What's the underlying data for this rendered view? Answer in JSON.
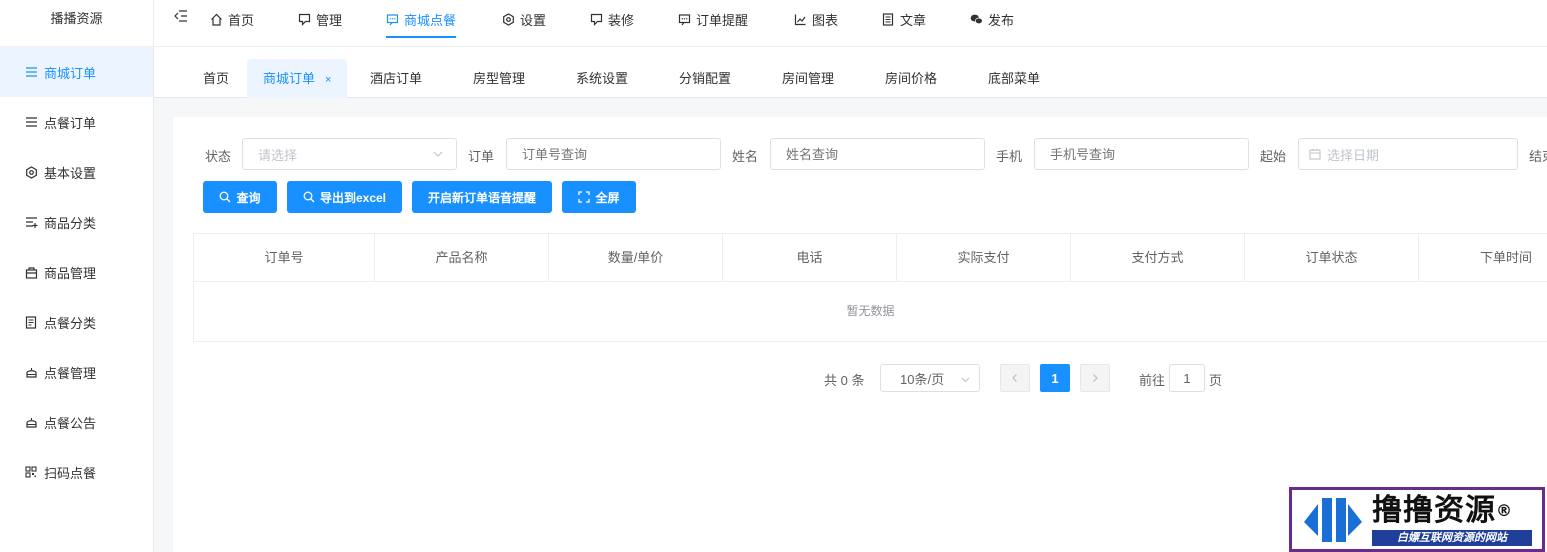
{
  "brand": "播播资源",
  "sidebar": {
    "items": [
      {
        "label": "商城订单",
        "icon": "list-icon",
        "active": true
      },
      {
        "label": "点餐订单",
        "icon": "list-icon"
      },
      {
        "label": "基本设置",
        "icon": "settings-hex-icon"
      },
      {
        "label": "商品分类",
        "icon": "list-add-icon"
      },
      {
        "label": "商品管理",
        "icon": "shop-icon"
      },
      {
        "label": "点餐分类",
        "icon": "document-icon"
      },
      {
        "label": "点餐管理",
        "icon": "cake-icon"
      },
      {
        "label": "点餐公告",
        "icon": "cake-icon"
      },
      {
        "label": "扫码点餐",
        "icon": "qrcode-icon"
      }
    ]
  },
  "topnav": {
    "items": [
      {
        "label": "首页",
        "icon": "home-icon"
      },
      {
        "label": "管理",
        "icon": "chat-square-icon"
      },
      {
        "label": "商城点餐",
        "icon": "message-icon",
        "active": true
      },
      {
        "label": "设置",
        "icon": "gear-icon"
      },
      {
        "label": "装修",
        "icon": "chat-square-icon"
      },
      {
        "label": "订单提醒",
        "icon": "message-icon"
      },
      {
        "label": "图表",
        "icon": "line-chart-icon"
      },
      {
        "label": "文章",
        "icon": "article-icon"
      },
      {
        "label": "发布",
        "icon": "wechat-icon"
      }
    ]
  },
  "tabs": [
    {
      "label": "首页"
    },
    {
      "label": "商城订单",
      "active": true,
      "close": "×"
    },
    {
      "label": "酒店订单"
    },
    {
      "label": "房型管理"
    },
    {
      "label": "系统设置"
    },
    {
      "label": "分销配置"
    },
    {
      "label": "房间管理"
    },
    {
      "label": "房间价格"
    },
    {
      "label": "底部菜单"
    }
  ],
  "filters": {
    "status": {
      "label": "状态",
      "placeholder": "请选择"
    },
    "order": {
      "label": "订单",
      "placeholder": "订单号查询"
    },
    "name": {
      "label": "姓名",
      "placeholder": "姓名查询"
    },
    "phone": {
      "label": "手机",
      "placeholder": "手机号查询"
    },
    "start": {
      "label": "起始",
      "placeholder": "选择日期"
    },
    "end": {
      "label": "结束"
    }
  },
  "buttons": {
    "query": "查询",
    "export": "导出到excel",
    "voice": "开启新订单语音提醒",
    "fullscreen": "全屏"
  },
  "table": {
    "columns": [
      "订单号",
      "产品名称",
      "数量/单价",
      "电话",
      "实际支付",
      "支付方式",
      "订单状态",
      "下单时间"
    ],
    "empty_text": "暂无数据"
  },
  "pagination": {
    "total_text": "共 0 条",
    "page_size": "10条/页",
    "current_page": "1",
    "goto_label": "前往",
    "goto_value": "1",
    "page_suffix": "页"
  },
  "watermark": {
    "main": "撸撸资源",
    "reg": "®",
    "sub": "白嫖互联网资源的网站"
  },
  "colors": {
    "accent": "#1890ff",
    "active_bg": "#ecf5ff",
    "watermark_border": "#6a2c8c",
    "watermark_band": "#1f3f9a"
  }
}
